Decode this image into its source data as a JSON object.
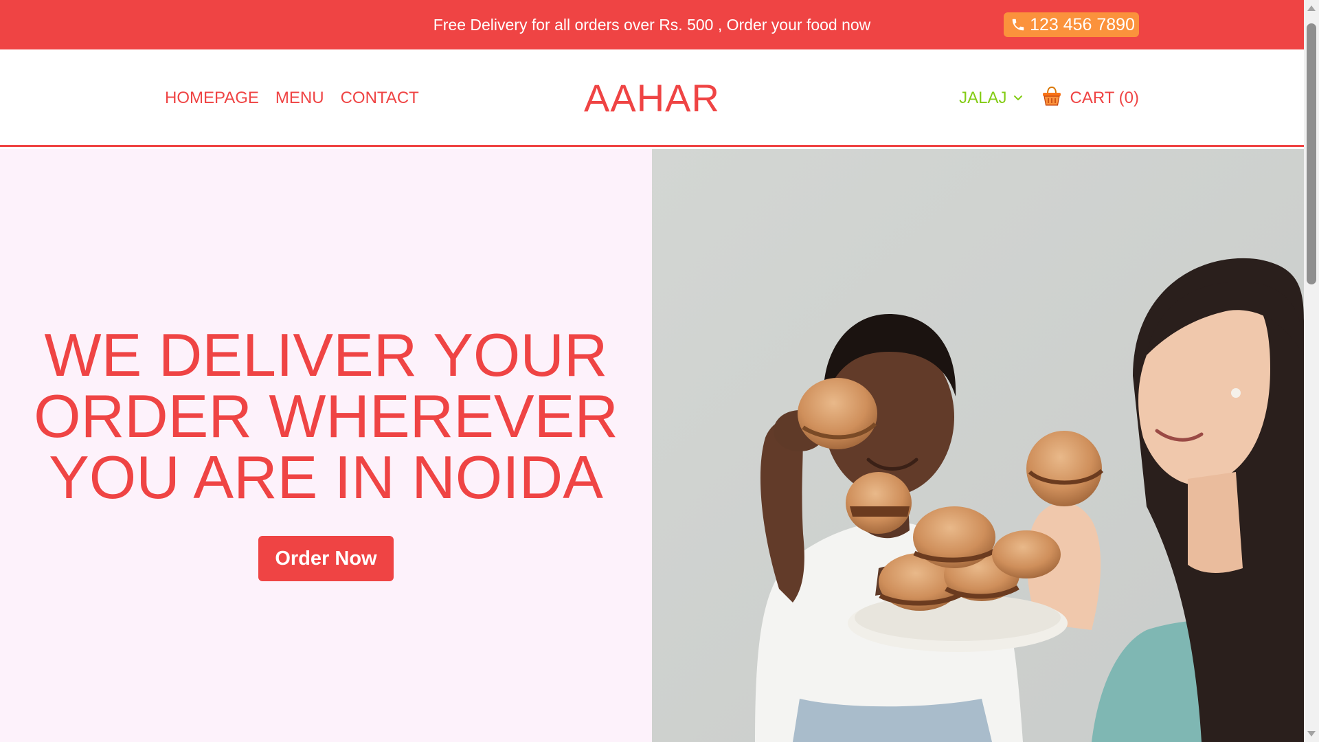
{
  "topbar": {
    "promo_text": "Free Delivery for all orders over Rs. 500 , Order your food now",
    "phone_number": "123 456 7890",
    "phone_icon": "phone-icon"
  },
  "nav": {
    "links": [
      "HOMEPAGE",
      "MENU",
      "CONTACT"
    ],
    "brand": "AAHAR",
    "user_label": "JALAJ",
    "user_icon": "chevron-down-icon",
    "cart_label": "CART (0)",
    "cart_icon": "basket-icon"
  },
  "hero": {
    "title_lines": [
      "WE DELIVER YOUR",
      "ORDER WHEREVER",
      "YOU ARE IN NOIDA"
    ],
    "cta_label": "Order Now",
    "image_description_icon": "hero-photo"
  },
  "colors": {
    "primary": "#ef4444",
    "phone_badge": "#fb923c",
    "user_accent": "#84cc16",
    "hero_bg": "#fdf2fb"
  }
}
